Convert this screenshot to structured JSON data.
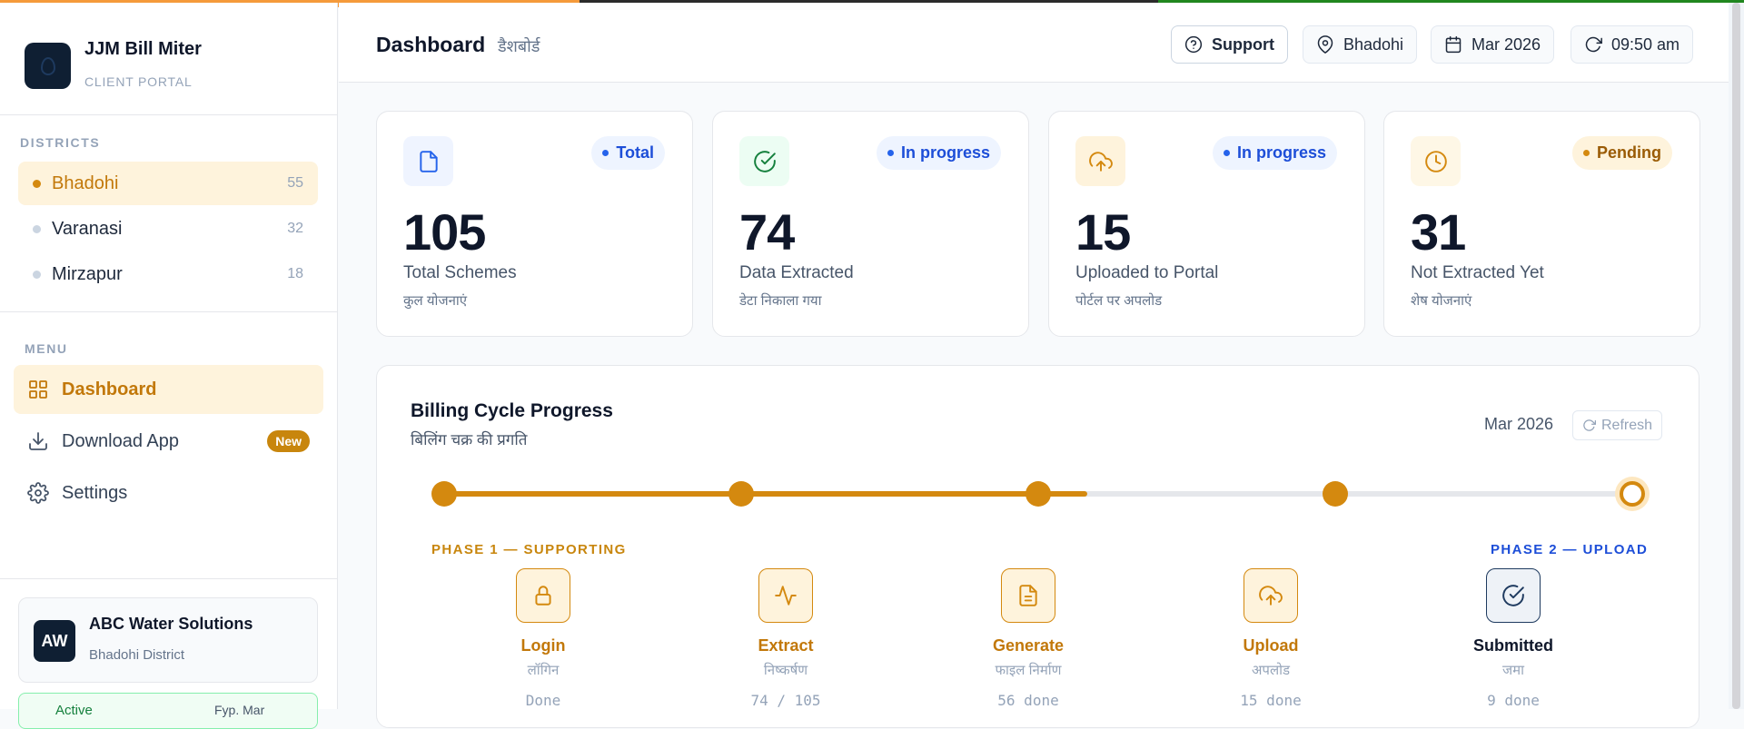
{
  "brand": {
    "name": "JJM Bill Miter",
    "subtitle": "CLIENT PORTAL"
  },
  "districts": {
    "label": "DISTRICTS",
    "items": [
      {
        "name": "Bhadohi",
        "count": "55",
        "active": true
      },
      {
        "name": "Varanasi",
        "count": "32",
        "active": false
      },
      {
        "name": "Mirzapur",
        "count": "18",
        "active": false
      }
    ]
  },
  "menu": {
    "label": "MENU",
    "items": [
      {
        "label": "Dashboard",
        "icon": "grid-icon",
        "active": true
      },
      {
        "label": "Download App",
        "icon": "download-icon",
        "badge": "New"
      },
      {
        "label": "Settings",
        "icon": "gear-icon"
      }
    ]
  },
  "client": {
    "initials": "AW",
    "name": "ABC Water Solutions",
    "district": "Bhadohi District",
    "status": "Active",
    "status_meta": "Fyp. Mar"
  },
  "header": {
    "title": "Dashboard",
    "title_hi": "डैशबोर्ड",
    "support": "Support",
    "location": "Bhadohi",
    "month": "Mar 2026",
    "time": "09:50 am"
  },
  "stats": [
    {
      "value": "105",
      "label": "Total Schemes",
      "label_hi": "कुल योजनाएं",
      "pill": "Total",
      "icon": "document-icon",
      "accent": "#2563eb"
    },
    {
      "value": "74",
      "label": "Data Extracted",
      "label_hi": "डेटा निकाला गया",
      "pill": "In progress",
      "icon": "check-circle-icon",
      "accent": "#15803d"
    },
    {
      "value": "15",
      "label": "Uploaded to Portal",
      "label_hi": "पोर्टल पर अपलोड",
      "pill": "In progress",
      "icon": "cloud-upload-icon",
      "accent": "#d4890f"
    },
    {
      "value": "31",
      "label": "Not Extracted Yet",
      "label_hi": "शेष योजनाएं",
      "pill": "Pending",
      "icon": "clock-icon",
      "accent": "#d4890f"
    }
  ],
  "billing": {
    "title": "Billing Cycle Progress",
    "title_hi": "बिलिंग चक्र की प्रगति",
    "month": "Mar 2026",
    "refresh": "Refresh",
    "progress_fraction": 0.54,
    "phase1": "PHASE 1 — SUPPORTING",
    "phase2": "PHASE 2 — UPLOAD",
    "steps": [
      {
        "name": "Login",
        "hi": "लॉगिन",
        "status": "Done",
        "icon": "lock-icon"
      },
      {
        "name": "Extract",
        "hi": "निष्कर्षण",
        "status": "74 / 105",
        "icon": "activity-icon"
      },
      {
        "name": "Generate",
        "hi": "फाइल निर्माण",
        "status": "56 done",
        "icon": "file-icon"
      },
      {
        "name": "Upload",
        "hi": "अपलोड",
        "status": "15 done",
        "icon": "cloud-upload-icon"
      },
      {
        "name": "Submitted",
        "hi": "जमा",
        "status": "9 done",
        "icon": "check-circle-icon"
      }
    ]
  },
  "colors": {
    "accent": "#d4890f",
    "navy": "#0f1f33",
    "blue": "#1d4ed8"
  }
}
